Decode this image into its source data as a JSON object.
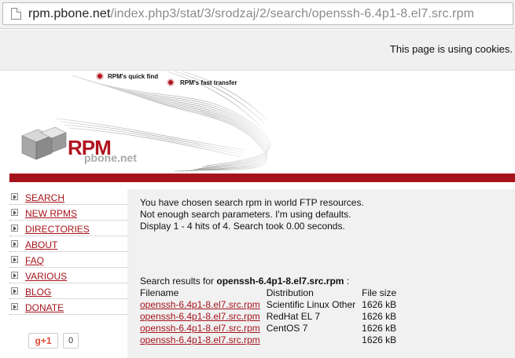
{
  "browser": {
    "url_domain": "rpm.pbone.net",
    "url_path": "/index.php3/stat/3/srodzaj/2/search/openssh-6.4p1-8.el7.src.rpm"
  },
  "cookie_notice": "This page is using cookies.",
  "banner": {
    "quick_find": "RPM's quick find",
    "fast_transfer": "RPM's fast transfer",
    "logo_main": "RPM",
    "logo_sub": "pbone.net"
  },
  "colors": {
    "accent": "#a5141c"
  },
  "sidebar": {
    "items": [
      {
        "label": "SEARCH"
      },
      {
        "label": "NEW RPMS"
      },
      {
        "label": "DIRECTORIES"
      },
      {
        "label": "ABOUT"
      },
      {
        "label": "FAQ"
      },
      {
        "label": "VARIOUS"
      },
      {
        "label": "BLOG"
      },
      {
        "label": "DONATE"
      }
    ],
    "gplus_label": "g+1",
    "gplus_count": "0"
  },
  "main": {
    "messages": [
      "You have chosen search rpm in world FTP resources.",
      "Not enough search parameters. I'm using defaults.",
      "Display 1 - 4 hits of 4. Search took 0.00 seconds."
    ],
    "results_prefix": "Search results for",
    "query": "openssh-6.4p1-8.el7.src.rpm",
    "results_suffix": ":",
    "columns": [
      "Filename",
      "Distribution",
      "File size"
    ],
    "rows": [
      {
        "filename": "openssh-6.4p1-8.el7.src.rpm",
        "distribution": "Scientific Linux Other",
        "size": "1626 kB"
      },
      {
        "filename": "openssh-6.4p1-8.el7.src.rpm",
        "distribution": "RedHat EL 7",
        "size": "1626 kB"
      },
      {
        "filename": "openssh-6.4p1-8.el7.src.rpm",
        "distribution": "CentOS 7",
        "size": "1626 kB"
      },
      {
        "filename": "openssh-6.4p1-8.el7.src.rpm",
        "distribution": "",
        "size": "1626 kB"
      }
    ]
  }
}
